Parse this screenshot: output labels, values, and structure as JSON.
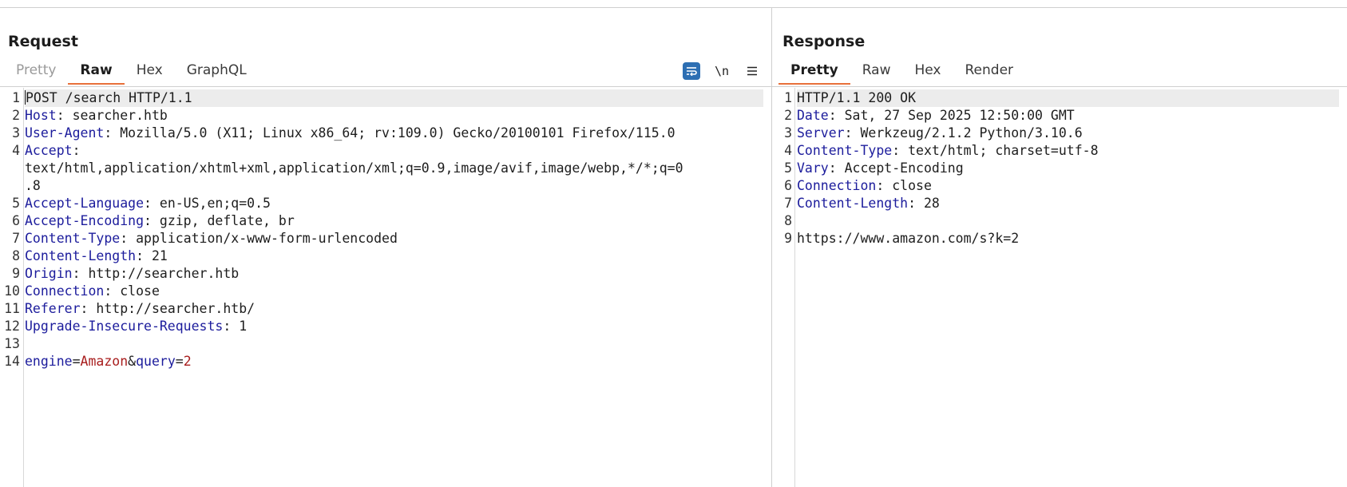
{
  "request": {
    "title": "Request",
    "tabs": [
      "Pretty",
      "Raw",
      "Hex",
      "GraphQL"
    ],
    "active_tab": "Raw",
    "newline_toggle": "\\n",
    "lines": [
      {
        "n": "1",
        "text": "POST /search HTTP/1.1"
      },
      {
        "n": "2",
        "key": "Host",
        "val": ": searcher.htb"
      },
      {
        "n": "3",
        "key": "User-Agent",
        "val": ": Mozilla/5.0 (X11; Linux x86_64; rv:109.0) Gecko/20100101 Firefox/115.0"
      },
      {
        "n": "4",
        "key": "Accept",
        "val": ":"
      },
      {
        "n": "",
        "text": "text/html,application/xhtml+xml,application/xml;q=0.9,image/avif,image/webp,*/*;q=0"
      },
      {
        "n": "",
        "text": ".8"
      },
      {
        "n": "5",
        "key": "Accept-Language",
        "val": ": en-US,en;q=0.5"
      },
      {
        "n": "6",
        "key": "Accept-Encoding",
        "val": ": gzip, deflate, br"
      },
      {
        "n": "7",
        "key": "Content-Type",
        "val": ": application/x-www-form-urlencoded"
      },
      {
        "n": "8",
        "key": "Content-Length",
        "val": ": 21"
      },
      {
        "n": "9",
        "key": "Origin",
        "val": ": http://searcher.htb"
      },
      {
        "n": "10",
        "key": "Connection",
        "val": ": close"
      },
      {
        "n": "11",
        "key": "Referer",
        "val": ": http://searcher.htb/"
      },
      {
        "n": "12",
        "key": "Upgrade-Insecure-Requests",
        "val": ": 1"
      },
      {
        "n": "13",
        "text": ""
      },
      {
        "n": "14",
        "params": [
          {
            "k": "engine",
            "v": "Amazon"
          },
          {
            "k": "query",
            "v": "2"
          }
        ]
      }
    ]
  },
  "response": {
    "title": "Response",
    "tabs": [
      "Pretty",
      "Raw",
      "Hex",
      "Render"
    ],
    "active_tab": "Pretty",
    "lines": [
      {
        "n": "1",
        "text": "HTTP/1.1 200 OK"
      },
      {
        "n": "2",
        "key": "Date",
        "val": ": Sat, 27 Sep 2025 12:50:00 GMT"
      },
      {
        "n": "3",
        "key": "Server",
        "val": ": Werkzeug/2.1.2 Python/3.10.6"
      },
      {
        "n": "4",
        "key": "Content-Type",
        "val": ": text/html; charset=utf-8"
      },
      {
        "n": "5",
        "key": "Vary",
        "val": ": Accept-Encoding"
      },
      {
        "n": "6",
        "key": "Connection",
        "val": ": close"
      },
      {
        "n": "7",
        "key": "Content-Length",
        "val": ": 28"
      },
      {
        "n": "8",
        "text": ""
      },
      {
        "n": "9",
        "text": "https://www.amazon.com/s?k=2"
      }
    ]
  },
  "colors": {
    "header_key": "#1c1c9c",
    "param_value": "#a81d1d",
    "active_tab_underline": "#e8703a",
    "wrap_button": "#2d6fb3"
  },
  "icons": {
    "wrap": "text-wrap-icon",
    "newline": "newline-toggle-icon",
    "menu": "hamburger-menu-icon"
  }
}
